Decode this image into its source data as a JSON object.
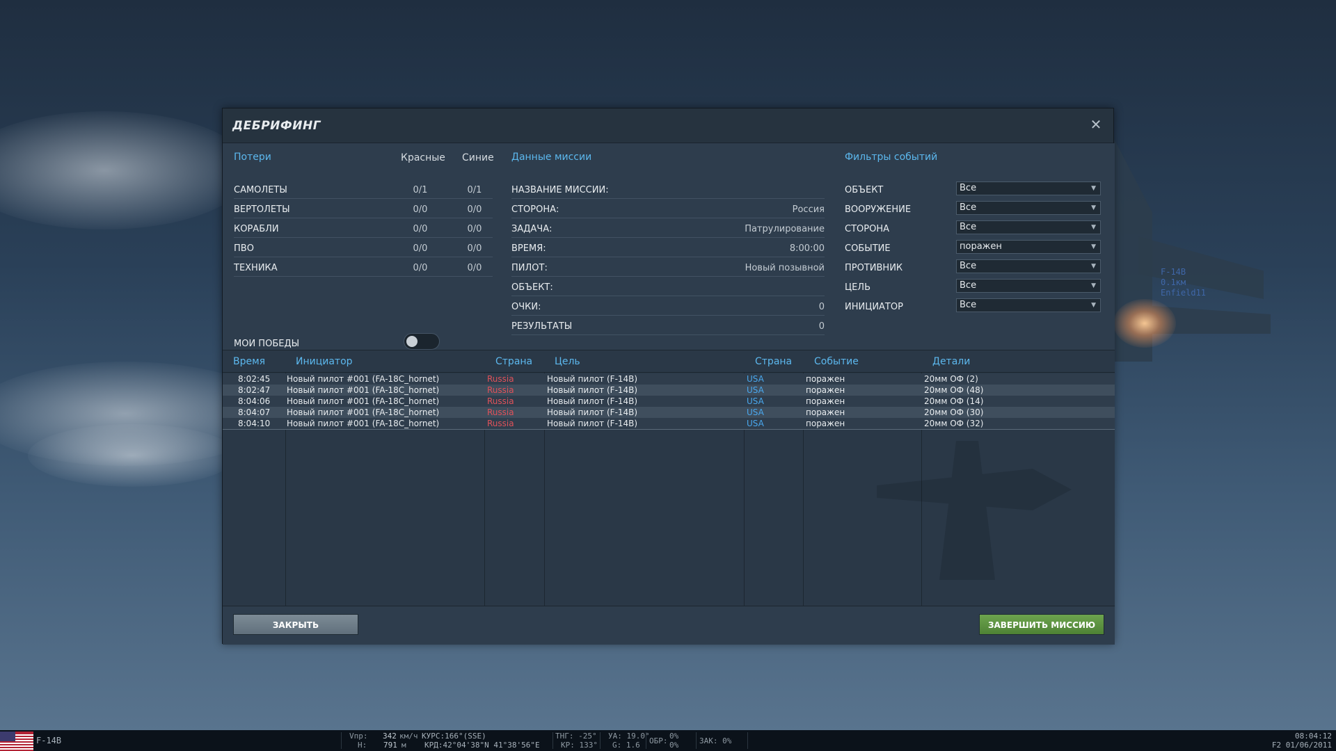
{
  "dialog": {
    "title": "ДЕБРИФИНГ",
    "close_icon": "close-icon"
  },
  "losses": {
    "title": "Потери",
    "col_red": "Красные",
    "col_blue": "Синие",
    "rows": [
      {
        "label": "САМОЛЕТЫ",
        "red": "0/1",
        "blue": "0/1"
      },
      {
        "label": "ВЕРТОЛЕТЫ",
        "red": "0/0",
        "blue": "0/0"
      },
      {
        "label": "КОРАБЛИ",
        "red": "0/0",
        "blue": "0/0"
      },
      {
        "label": "ПВО",
        "red": "0/0",
        "blue": "0/0"
      },
      {
        "label": "ТЕХНИКА",
        "red": "0/0",
        "blue": "0/0"
      }
    ],
    "my_wins_label": "МОИ ПОБЕДЫ",
    "my_wins_on": false
  },
  "mission": {
    "title": "Данные миссии",
    "rows": [
      {
        "label": "НАЗВАНИЕ МИССИИ:",
        "value": ""
      },
      {
        "label": "СТОРОНА:",
        "value": "Россия"
      },
      {
        "label": "ЗАДАЧА:",
        "value": "Патрулирование"
      },
      {
        "label": "ВРЕМЯ:",
        "value": "8:00:00"
      },
      {
        "label": "ПИЛОТ:",
        "value": "Новый позывной"
      },
      {
        "label": "ОБЪЕКТ:",
        "value": ""
      },
      {
        "label": "ОЧКИ:",
        "value": "0"
      },
      {
        "label": "РЕЗУЛЬТАТЫ",
        "value": "0"
      }
    ]
  },
  "filters": {
    "title": "Фильтры событий",
    "rows": [
      {
        "label": "ОБЪЕКТ",
        "value": "Все"
      },
      {
        "label": "ВООРУЖЕНИЕ",
        "value": "Все"
      },
      {
        "label": "СТОРОНА",
        "value": "Все"
      },
      {
        "label": "СОБЫТИЕ",
        "value": "поражен"
      },
      {
        "label": "ПРОТИВНИК",
        "value": "Все"
      },
      {
        "label": "ЦЕЛЬ",
        "value": "Все"
      },
      {
        "label": "ИНИЦИАТОР",
        "value": "Все"
      }
    ]
  },
  "events": {
    "headers": [
      "Время",
      "Инициатор",
      "Страна",
      "Цель",
      "Страна",
      "Событие",
      "Детали"
    ],
    "rows": [
      {
        "time": "8:02:45",
        "initiator": "Новый пилот #001 (FA-18C_hornet)",
        "country1": "Russia",
        "target": "Новый пилот (F-14B)",
        "country2": "USA",
        "event": "поражен",
        "details": "20мм ОФ (2)"
      },
      {
        "time": "8:02:47",
        "initiator": "Новый пилот #001 (FA-18C_hornet)",
        "country1": "Russia",
        "target": "Новый пилот (F-14B)",
        "country2": "USA",
        "event": "поражен",
        "details": "20мм ОФ (48)"
      },
      {
        "time": "8:04:06",
        "initiator": "Новый пилот #001 (FA-18C_hornet)",
        "country1": "Russia",
        "target": "Новый пилот (F-14B)",
        "country2": "USA",
        "event": "поражен",
        "details": "20мм ОФ (14)"
      },
      {
        "time": "8:04:07",
        "initiator": "Новый пилот #001 (FA-18C_hornet)",
        "country1": "Russia",
        "target": "Новый пилот (F-14B)",
        "country2": "USA",
        "event": "поражен",
        "details": "20мм ОФ (30)"
      },
      {
        "time": "8:04:10",
        "initiator": "Новый пилот #001 (FA-18C_hornet)",
        "country1": "Russia",
        "target": "Новый пилот (F-14B)",
        "country2": "USA",
        "event": "поражен",
        "details": "20мм ОФ (32)"
      }
    ]
  },
  "buttons": {
    "close": "ЗАКРЫТЬ",
    "finish": "ЗАВЕРШИТЬ МИССИЮ"
  },
  "hud": {
    "aircraft": "F-14B",
    "vpr_label": "Vпр:",
    "vpr_value": "342",
    "vpr_unit": "км/ч",
    "h_label": "Н:",
    "h_value": "791",
    "h_unit": "м",
    "course": "КУРС:166°(SSE)",
    "coords": "КРД:42°04'38\"N 41°38'56\"E",
    "thg": "ТНГ: -25°",
    "kr": "КР: 133°",
    "ua": "УА: 19.0°",
    "g": "G: 1.6",
    "obr_label": "ОБР:",
    "obr1": "0%",
    "obr2": "0%",
    "zak": "ЗАК: 0%",
    "time": "08:04:12",
    "date": "F2 01/06/2011"
  },
  "scene": {
    "jet_labels": [
      "F-14B",
      "0.1км",
      "Enfield11"
    ]
  },
  "colors": {
    "accent": "#5cb8ee",
    "russia": "#e0525a",
    "usa": "#4aa8ee",
    "finish_button": "#5c9441"
  }
}
